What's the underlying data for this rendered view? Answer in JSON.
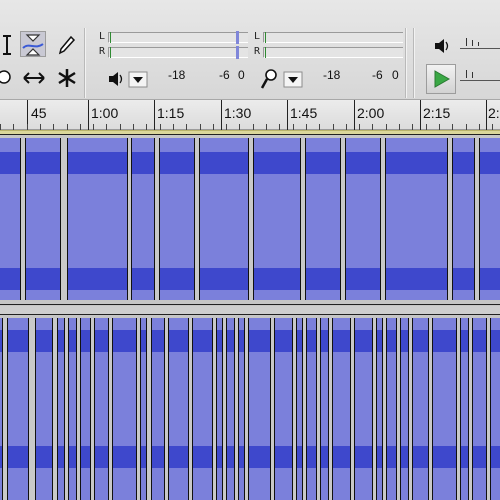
{
  "toolbar": {
    "tools": [
      {
        "id": "selection-tool",
        "icon": "i-beam-icon"
      },
      {
        "id": "envelope-tool",
        "icon": "envelope-icon"
      },
      {
        "id": "draw-tool",
        "icon": "pencil-icon"
      },
      {
        "id": "zoom-tool",
        "icon": "magnifier-icon"
      },
      {
        "id": "timeshift-tool",
        "icon": "double-arrow-icon"
      },
      {
        "id": "multi-tool",
        "icon": "asterisk-icon"
      }
    ],
    "playback_meter": {
      "channel_labels": [
        "L",
        "R"
      ],
      "scale": [
        "-18",
        "-6",
        "0"
      ],
      "icon": "speaker-icon"
    },
    "record_meter": {
      "channel_labels": [
        "L",
        "R"
      ],
      "scale": [
        "-18",
        "-6",
        "0"
      ],
      "icon": "microphone-icon"
    },
    "mixer": {
      "volume_icon": "speaker-volume-icon",
      "play_icon": "play-icon",
      "play_color": "#3aa845"
    }
  },
  "ruler": {
    "labels": [
      "45",
      "1:00",
      "1:15",
      "1:30",
      "1:45",
      "2:00",
      "2:15",
      "2:"
    ]
  },
  "colors": {
    "waveform_light": "#7b80db",
    "waveform_dark": "#3e48cc",
    "clip_gap": "#c9c9c9",
    "background": "#d9d9d9"
  }
}
